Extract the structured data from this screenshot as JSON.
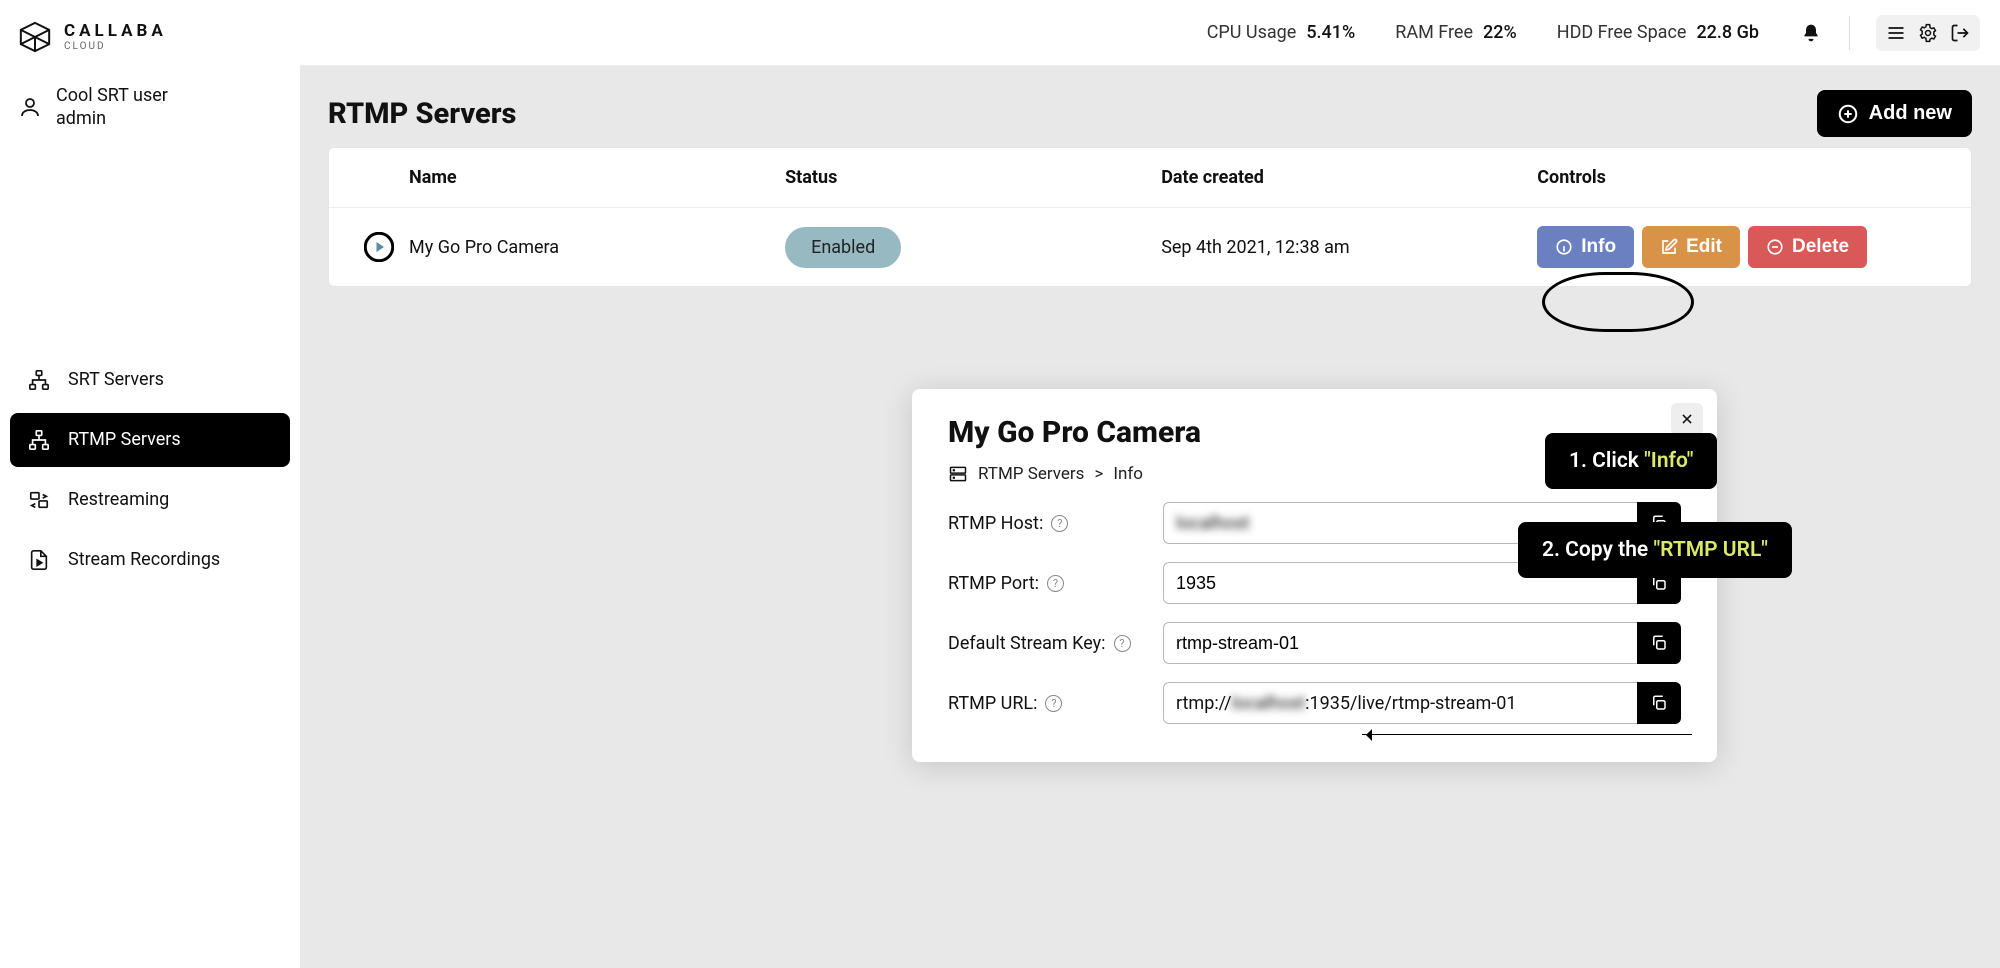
{
  "logo": {
    "title": "CALLABA",
    "sub": "CLOUD"
  },
  "user": {
    "line1": "Cool SRT user",
    "line2": "admin"
  },
  "nav": {
    "items": [
      {
        "label": "SRT Servers"
      },
      {
        "label": "RTMP Servers"
      },
      {
        "label": "Restreaming"
      },
      {
        "label": "Stream Recordings"
      }
    ]
  },
  "stats": {
    "cpu_label": "CPU Usage",
    "cpu_value": "5.41%",
    "ram_label": "RAM Free",
    "ram_value": "22%",
    "hdd_label": "HDD Free Space",
    "hdd_value": "22.8 Gb"
  },
  "page": {
    "title": "RTMP Servers",
    "add_label": "Add new"
  },
  "table": {
    "headers": {
      "name": "Name",
      "status": "Status",
      "date": "Date created",
      "controls": "Controls"
    },
    "row": {
      "name": "My Go Pro Camera",
      "status": "Enabled",
      "date": "Sep 4th 2021, 12:38 am",
      "info": "Info",
      "edit": "Edit",
      "delete": "Delete"
    }
  },
  "modal": {
    "title": "My Go Pro Camera",
    "crumb1": "RTMP Servers",
    "crumb_sep": ">",
    "crumb2": "Info",
    "fields": {
      "host_label": "RTMP Host:",
      "host_value": "localhost",
      "port_label": "RTMP Port:",
      "port_value": "1935",
      "key_label": "Default Stream Key:",
      "key_value": "rtmp-stream-01",
      "url_label": "RTMP URL:",
      "url_prefix": "rtmp://",
      "url_host": "localhost",
      "url_suffix": ":1935/live/rtmp-stream-01"
    }
  },
  "annotations": {
    "a1_pre": "1. Click ",
    "a1_hl": "\"Info\"",
    "a2_pre": "2. Copy the ",
    "a2_hl": "\"RTMP URL\""
  }
}
